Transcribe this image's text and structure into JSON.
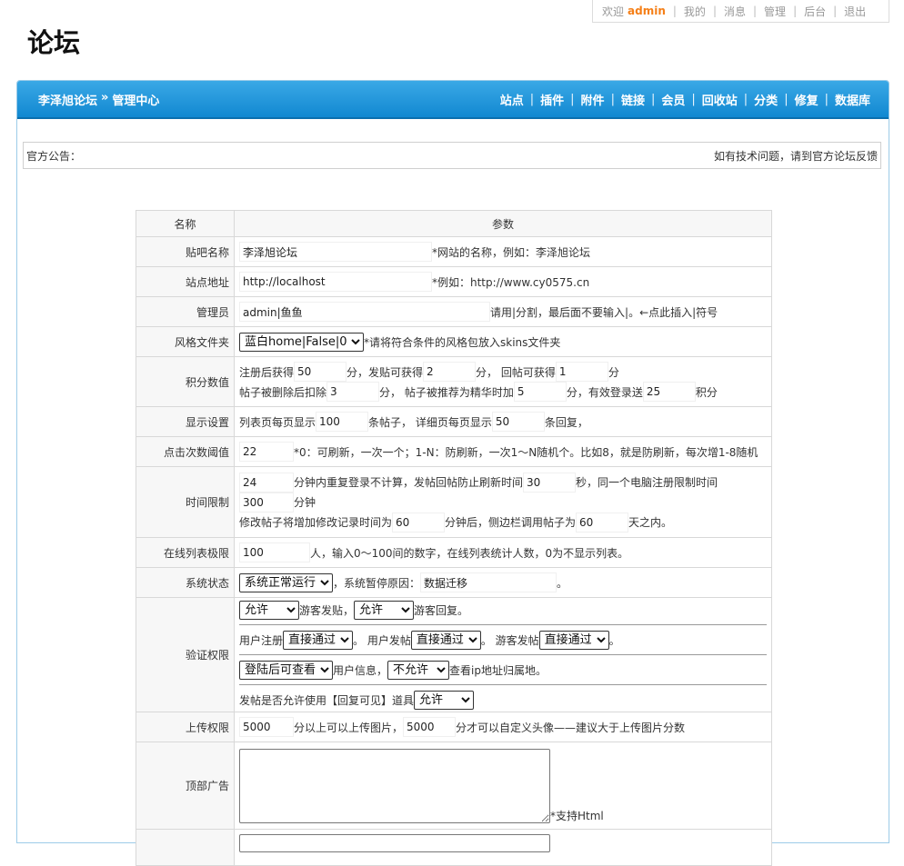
{
  "userbar": {
    "welcome": "欢迎",
    "username": "admin",
    "links": [
      "我的",
      "消息",
      "管理",
      "后台",
      "退出"
    ]
  },
  "logo": "论坛",
  "nav": {
    "crumb_site": "李泽旭论坛",
    "crumb_sep": "»",
    "crumb_page": "管理中心",
    "menu": [
      "站点",
      "插件",
      "附件",
      "链接",
      "会员",
      "回收站",
      "分类",
      "修复",
      "数据库"
    ]
  },
  "notice": {
    "left": "官方公告：",
    "right": "如有技术问题，请到官方论坛反馈"
  },
  "table": {
    "header_name": "名称",
    "header_param": "参数",
    "site_name": {
      "label": "贴吧名称",
      "value": "李泽旭论坛",
      "hint": "*网站的名称，例如：李泽旭论坛"
    },
    "site_url": {
      "label": "站点地址",
      "value": "http://localhost",
      "hint": "*例如：http://www.cy0575.cn"
    },
    "admins": {
      "label": "管理员",
      "value": "admin|鱼鱼",
      "hint": "请用|分割，最后面不要输入|。←点此插入|符号"
    },
    "skin": {
      "label": "风格文件夹",
      "selected": "蓝白home|False|0",
      "hint": "*请将符合条件的风格包放入skins文件夹"
    },
    "points": {
      "label": "积分数值",
      "t1": "注册后获得",
      "v1": "50",
      "t2": "分，发贴可获得",
      "v2": "2",
      "t3": "分， 回帖可获得",
      "v3": "1",
      "t4": "分",
      "t5": "帖子被删除后扣除",
      "v4": "3",
      "t6": "分， 帖子被推荐为精华时加",
      "v5": "5",
      "t7": "分，有效登录送",
      "v6": "25",
      "t8": "积分"
    },
    "display": {
      "label": "显示设置",
      "t1": "列表页每页显示",
      "v1": "100",
      "t2": "条帖子， 详细页每页显示",
      "v2": "50",
      "t3": "条回复，"
    },
    "clicks": {
      "label": "点击次数阈值",
      "value": "22",
      "hint": "*0：可刷新，一次一个；1-N：防刷新，一次1～N随机个。比如8，就是防刷新，每次增1-8随机"
    },
    "time": {
      "label": "时间限制",
      "v1": "24",
      "t1": "分钟内重复登录不计算，发帖回帖防止刷新时间",
      "v2": "30",
      "t2": "秒，同一个电脑注册限制时间",
      "v3": "300",
      "t3": "分钟",
      "t4": "修改帖子将增加修改记录时间为",
      "v4": "60",
      "t5": "分钟后，侧边栏调用帖子为",
      "v5": "60",
      "t6": "天之内。"
    },
    "online": {
      "label": "在线列表极限",
      "value": "100",
      "hint": "人，输入0～100间的数字，在线列表统计人数，0为不显示列表。"
    },
    "status": {
      "label": "系统状态",
      "selected": "系统正常运行",
      "t1": "，系统暂停原因：",
      "reason": "数据迁移",
      "t2": "。"
    },
    "verify": {
      "label": "验证权限",
      "guest_post": "允许",
      "t1": "游客发贴，",
      "guest_reply": "允许",
      "t2": "游客回复。",
      "t3": "用户注册",
      "user_reg": "直接通过",
      "t4": "。 用户发帖",
      "user_post": "直接通过",
      "t5": "。 游客发帖",
      "guest_post2": "直接通过",
      "t6": "。",
      "user_info": "登陆后可查看",
      "t7": "用户信息，",
      "ip_view": "不允许",
      "t8": "查看ip地址归属地。",
      "t9": "发帖是否允许使用【回复可见】道具",
      "reply_visible": "允许"
    },
    "upload": {
      "label": "上传权限",
      "v1": "5000",
      "t1": "分以上可以上传图片，",
      "v2": "5000",
      "t2": "分才可以自定义头像——建议大于上传图片分数"
    },
    "ad": {
      "label": "顶部广告",
      "hint": "*支持Html"
    }
  }
}
